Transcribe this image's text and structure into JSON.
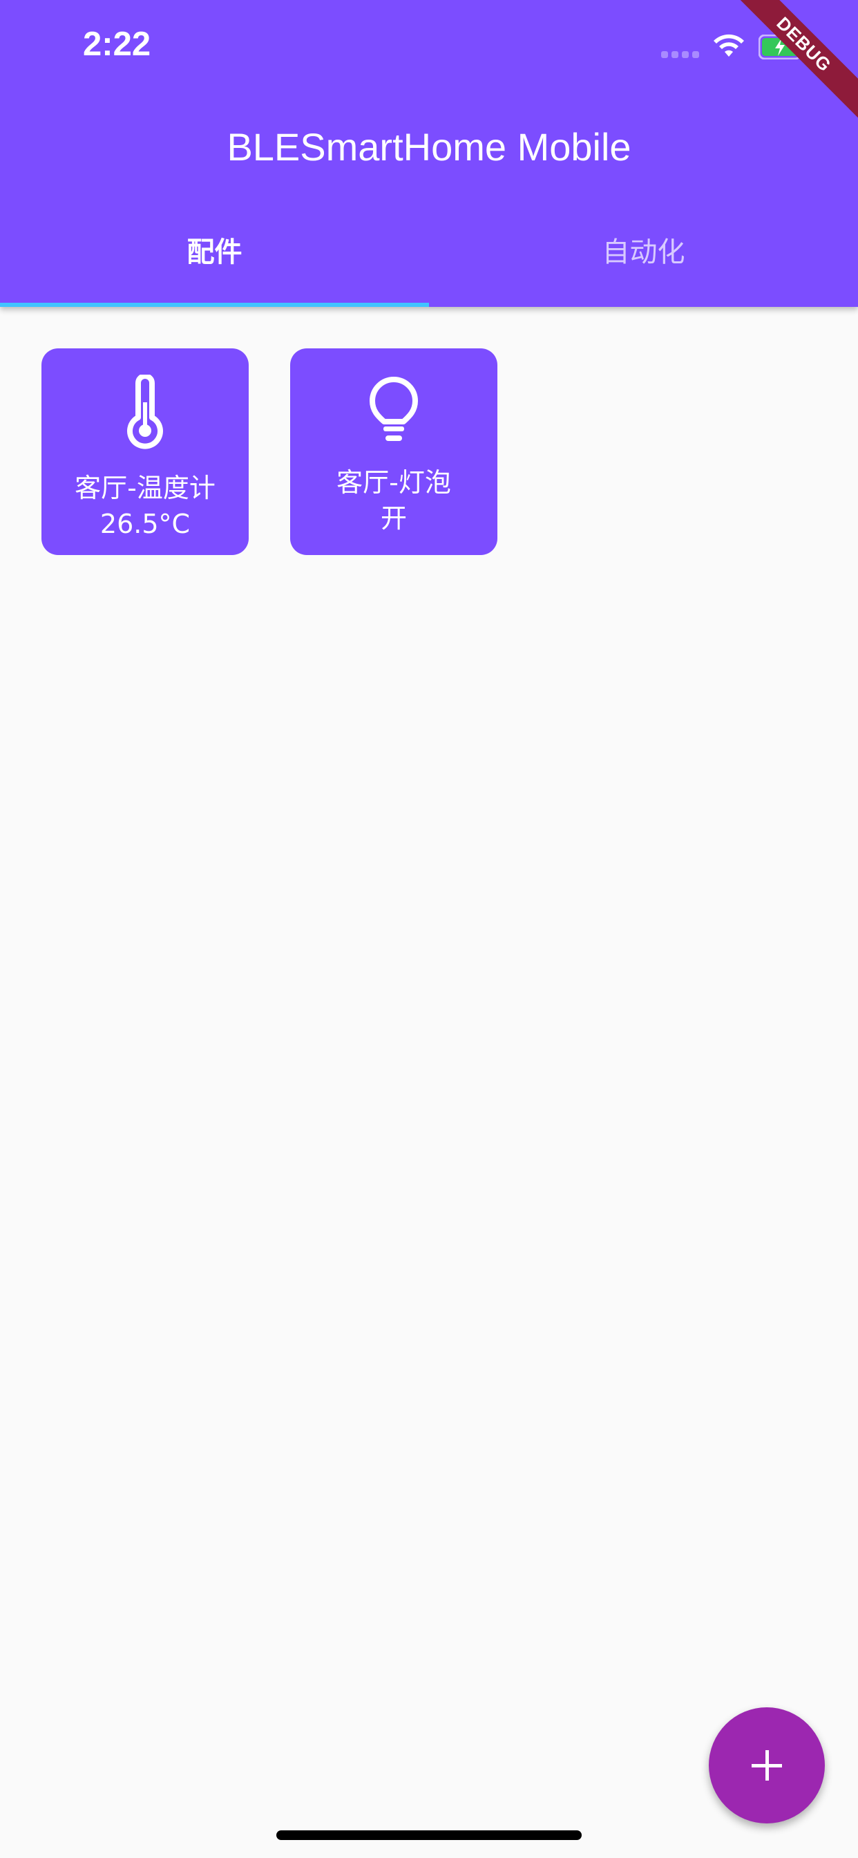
{
  "status_bar": {
    "time": "2:22"
  },
  "debug_banner": "DEBUG",
  "app_bar": {
    "title": "BLESmartHome Mobile",
    "tabs": [
      {
        "label": "配件",
        "selected": true
      },
      {
        "label": "自动化",
        "selected": false
      }
    ]
  },
  "accessories": [
    {
      "icon": "thermometer-icon",
      "name": "客厅-温度计",
      "state": "26.5°C"
    },
    {
      "icon": "lightbulb-icon",
      "name": "客厅-灯泡",
      "state": "开"
    }
  ],
  "fab": {
    "icon": "plus-icon"
  },
  "colors": {
    "primary": "#7c4dff",
    "fab": "#9c27b0",
    "tab_indicator": "#40c4ff",
    "background": "#fafafa"
  }
}
